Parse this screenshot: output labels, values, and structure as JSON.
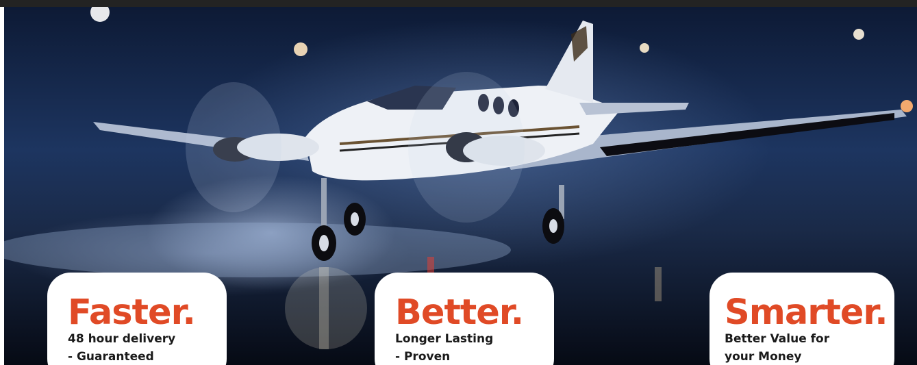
{
  "hero": {
    "image_alt": "Twin-engine turboprop aircraft on a wet runway at night"
  },
  "cards": [
    {
      "heading": "Faster.",
      "line1": "48 hour delivery",
      "line2": "- Guaranteed"
    },
    {
      "heading": "Better.",
      "line1": "Longer Lasting",
      "line2": "- Proven"
    },
    {
      "heading": "Smarter.",
      "line1": "Better Value for",
      "line2": "your Money"
    }
  ],
  "colors": {
    "accent": "#e04a26",
    "text": "#1a1a1a",
    "top_bar": "#232323",
    "card_bg": "#ffffff"
  }
}
